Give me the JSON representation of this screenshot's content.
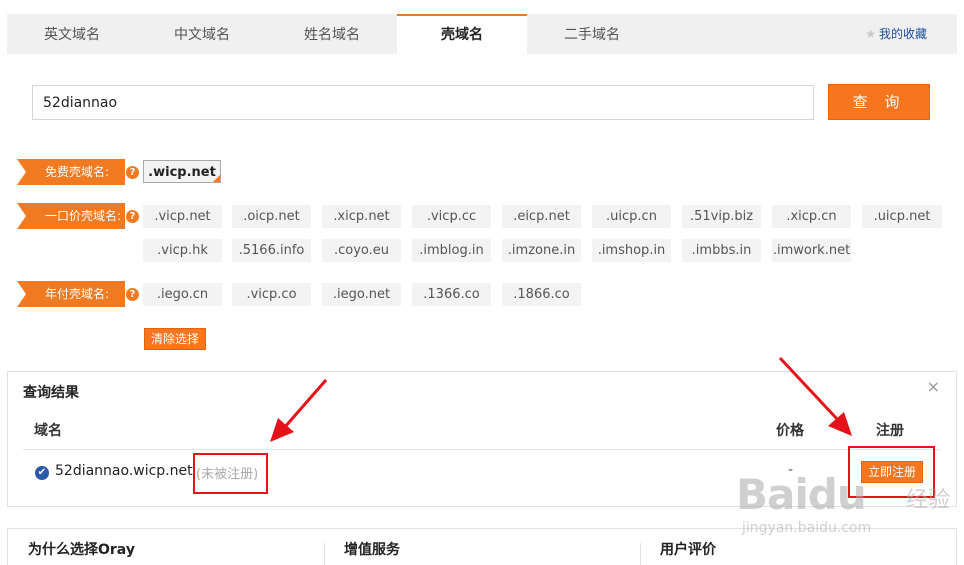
{
  "tabs": [
    {
      "label": "英文域名"
    },
    {
      "label": "中文域名"
    },
    {
      "label": "姓名域名"
    },
    {
      "label": "壳域名"
    },
    {
      "label": "二手域名"
    }
  ],
  "favorites_label": "我的收藏",
  "search": {
    "value": "52diannao",
    "button_label": "查 询"
  },
  "free": {
    "label": "免费壳域名:",
    "help": "?",
    "domains": [
      ".wicp.net"
    ]
  },
  "fixed_price": {
    "label": "一口价壳域名:",
    "help": "?",
    "domains": [
      ".vicp.net",
      ".oicp.net",
      ".xicp.net",
      ".vicp.cc",
      ".eicp.net",
      ".uicp.cn",
      ".51vip.biz",
      ".xicp.cn",
      ".uicp.net",
      ".vicp.hk",
      ".5166.info",
      ".coyo.eu",
      ".imblog.in",
      ".imzone.in",
      ".imshop.in",
      ".imbbs.in",
      ".imwork.net"
    ]
  },
  "annual": {
    "label": "年付壳域名:",
    "help": "?",
    "domains": [
      ".iego.cn",
      ".vicp.co",
      ".iego.net",
      ".1366.co",
      ".1866.co"
    ]
  },
  "clear_label": "清除选择",
  "results": {
    "title": "查询结果",
    "close": "×",
    "headers": {
      "domain": "域名",
      "price": "价格",
      "register": "注册"
    },
    "row": {
      "domain": "52diannao.wicp.net",
      "status": "(未被注册)",
      "price": "-",
      "action": "立即注册"
    }
  },
  "bottom": {
    "why": "为什么选择Oray",
    "value_added": "增值服务",
    "reviews": "用户评价"
  },
  "watermark": {
    "logo": "Baidu",
    "sub": "经验",
    "site": "jingyan.baidu.com"
  },
  "colors": {
    "accent": "#f6761f",
    "link": "#1e4e9c",
    "annotation": "#e5121a"
  }
}
